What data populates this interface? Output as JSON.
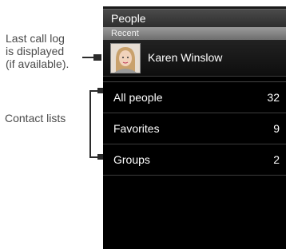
{
  "callouts": {
    "recent_line1": "Last call log",
    "recent_line2": "is displayed",
    "recent_line3": "(if available).",
    "contacts": "Contact lists"
  },
  "phone": {
    "title": "People",
    "section": "Recent",
    "recent": {
      "name": "Karen Winslow",
      "icon": "contact-photo"
    },
    "lists": [
      {
        "label": "All people",
        "count": "32"
      },
      {
        "label": "Favorites",
        "count": "9"
      },
      {
        "label": "Groups",
        "count": "2"
      }
    ]
  },
  "colors": {
    "screen_bg": "#000000",
    "title_bar": "#3a3a3a",
    "section_bar": "#8a8a8a"
  }
}
